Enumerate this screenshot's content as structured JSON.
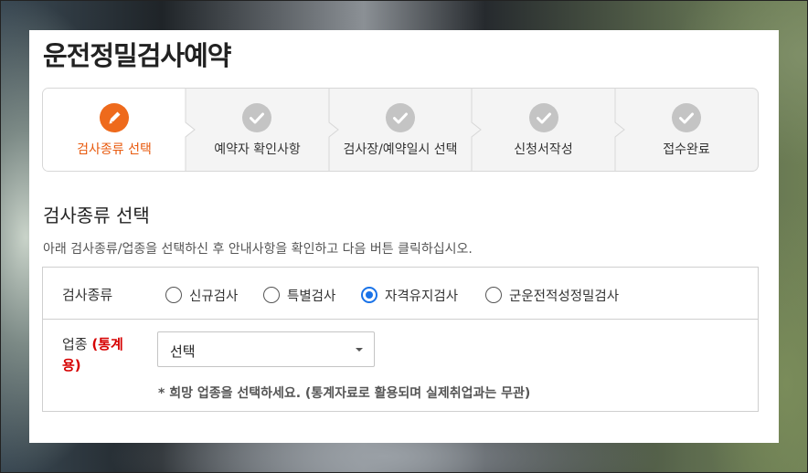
{
  "page": {
    "title": "운전정밀검사예약"
  },
  "steps": [
    {
      "label": "검사종류 선택",
      "icon": "pencil-icon",
      "active": true
    },
    {
      "label": "예약자 확인사항",
      "icon": "check-icon",
      "active": false
    },
    {
      "label": "검사장/예약일시 선택",
      "icon": "check-icon",
      "active": false
    },
    {
      "label": "신청서작성",
      "icon": "check-icon",
      "active": false
    },
    {
      "label": "접수완료",
      "icon": "check-icon",
      "active": false
    }
  ],
  "section": {
    "title": "검사종류 선택",
    "description": "아래 검사종류/업종을 선택하신 후 안내사항을 확인하고 다음 버튼 클릭하십시오."
  },
  "form": {
    "exam_type": {
      "label": "검사종류",
      "options": [
        {
          "label": "신규검사",
          "checked": false
        },
        {
          "label": "특별검사",
          "checked": false
        },
        {
          "label": "자격유지검사",
          "checked": true
        },
        {
          "label": "군운전적성정밀검사",
          "checked": false
        }
      ]
    },
    "industry": {
      "label": "업종",
      "label_note": "(통계용)",
      "select_value": "선택",
      "hint": "* 희망 업종을 선택하세요. (통계자료로 활용되며 실제취업과는 무관)"
    }
  },
  "colors": {
    "accent": "#ee6a1c",
    "inactive_step": "#c4c4c4",
    "radio_checked": "#1a73e8",
    "note_red": "#d60000"
  }
}
